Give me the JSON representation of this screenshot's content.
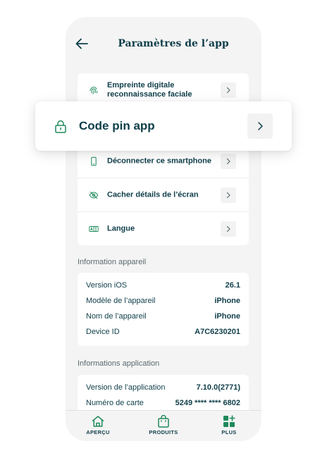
{
  "header": {
    "title": "Paramètres de l’app"
  },
  "settings": {
    "items": [
      {
        "label": "Empreinte digitale reconnaissance faciale",
        "icon": "fingerprint-icon"
      },
      {
        "label": "Code pin app",
        "icon": "lock-icon"
      },
      {
        "label": "Déconnecter ce smartphone",
        "icon": "smartphone-icon"
      },
      {
        "label": "Cacher détails de l’écran",
        "icon": "eye-off-icon"
      },
      {
        "label": "Langue",
        "icon": "language-icon"
      }
    ]
  },
  "device_info": {
    "section_label": "Information appareil",
    "rows": [
      {
        "key": "Version iOS",
        "value": "26.1"
      },
      {
        "key": "Modèle de l’appareil",
        "value": "iPhone"
      },
      {
        "key": "Nom de l’appareil",
        "value": "iPhone"
      },
      {
        "key": "Device ID",
        "value": "A7C6230201"
      }
    ]
  },
  "app_info": {
    "section_label": "Informations application",
    "rows": [
      {
        "key": "Version de l’application",
        "value": "7.10.0(2771)"
      },
      {
        "key": "Numéro de carte",
        "value": "5249 **** **** 6802"
      }
    ]
  },
  "bottom_nav": {
    "items": [
      {
        "label": "APERÇU",
        "icon": "home-icon"
      },
      {
        "label": "PRODUITS",
        "icon": "shopping-bag-icon"
      },
      {
        "label": "PLUS",
        "icon": "grid-plus-icon"
      }
    ]
  },
  "colors": {
    "accent": "#1f8a5b",
    "text": "#0f3e4a",
    "background": "#f4f4f4"
  }
}
